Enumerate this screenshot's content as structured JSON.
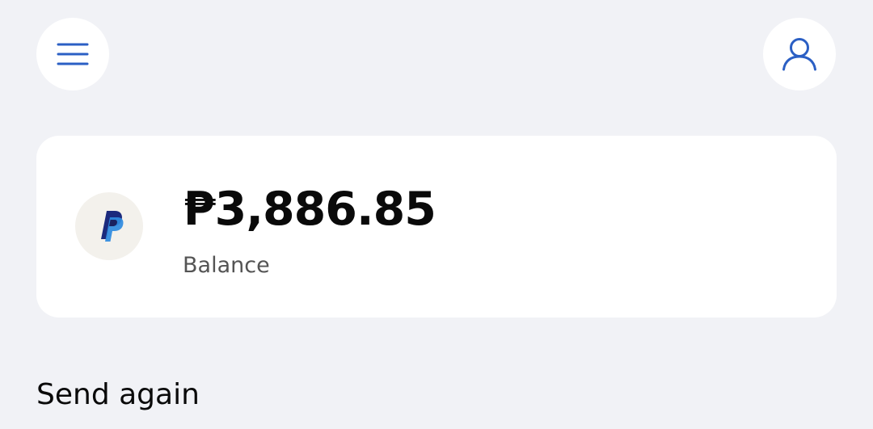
{
  "header": {
    "menu_icon": "hamburger-menu-icon",
    "profile_icon": "user-profile-icon",
    "accent_color": "#2b5fc4"
  },
  "balance_card": {
    "logo": "paypal-logo",
    "amount": "₱3,886.85",
    "label": "Balance"
  },
  "send_again": {
    "title": "Send again"
  }
}
